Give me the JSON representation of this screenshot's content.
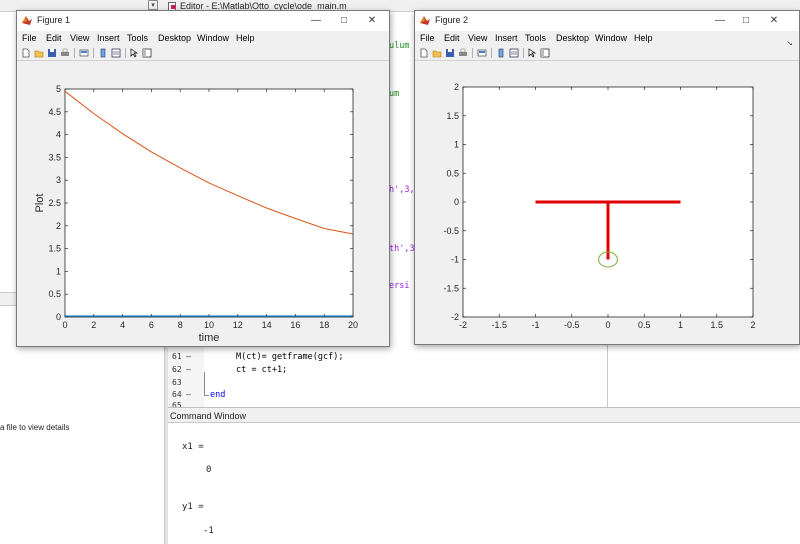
{
  "editor": {
    "title": "Editor - E:\\Matlab\\Otto_cycle\\ode_main.m",
    "code_fragments": [
      {
        "text": "ulum",
        "class": "cmt"
      },
      {
        "text": "um",
        "class": "cmt"
      },
      {
        "text": "h',3,",
        "class": "str"
      },
      {
        "text": "th',3",
        "class": "str"
      },
      {
        "text": "ersi",
        "class": "str"
      }
    ],
    "lines": [
      {
        "num": "61",
        "marker": "—",
        "code": "M(ct)= getframe(gcf);"
      },
      {
        "num": "62",
        "marker": "—",
        "code": "ct = ct+1;"
      },
      {
        "num": "63",
        "marker": "",
        "code": ""
      },
      {
        "num": "64",
        "marker": "—",
        "code": "end"
      },
      {
        "num": "65",
        "marker": "",
        "code": ""
      }
    ]
  },
  "left_panel": {
    "detail_text": "a file to view details"
  },
  "command_window": {
    "header": "Command Window",
    "lines": [
      "x1 =",
      "0",
      "y1 =",
      "-1"
    ]
  },
  "figure1": {
    "title": "Figure 1",
    "menus": [
      "File",
      "Edit",
      "View",
      "Insert",
      "Tools",
      "Desktop",
      "Window",
      "Help"
    ],
    "win_buttons": {
      "minimize": "—",
      "maximize": "□",
      "close": "✕"
    }
  },
  "figure2": {
    "title": "Figure 2",
    "menus": [
      "File",
      "Edit",
      "View",
      "Insert",
      "Tools",
      "Desktop",
      "Window",
      "Help"
    ],
    "win_buttons": {
      "minimize": "—",
      "maximize": "□",
      "close": "✕"
    },
    "dock_arrow": "↘"
  },
  "colors": {
    "curve1": "#d95319",
    "curve2": "#0072bd",
    "pendulum": "#e00000",
    "bob": "#77ac30"
  },
  "chart_data": [
    {
      "type": "line",
      "xlabel": "time",
      "ylabel": "Plot",
      "xlim": [
        0,
        20
      ],
      "ylim": [
        0,
        5
      ],
      "xticks": [
        0,
        2,
        4,
        6,
        8,
        10,
        12,
        14,
        16,
        18,
        20
      ],
      "yticks": [
        0,
        0.5,
        1,
        1.5,
        2,
        2.5,
        3,
        3.5,
        4,
        4.5,
        5
      ],
      "ytick_labels": [
        "0",
        "0.5",
        "1",
        "1.5",
        "2",
        "2.5",
        "3",
        "3.5",
        "4",
        "4.5",
        "5"
      ],
      "grid": false,
      "series": [
        {
          "color": "#d95319",
          "x": [
            0,
            2,
            4,
            6,
            8,
            10,
            12,
            14,
            16,
            18,
            20
          ],
          "y": [
            4.95,
            4.46,
            4.02,
            3.62,
            3.27,
            2.94,
            2.66,
            2.39,
            2.16,
            1.94,
            1.82
          ]
        },
        {
          "color": "#0072bd",
          "x": [
            0,
            20
          ],
          "y": [
            0.02,
            0.02
          ]
        }
      ]
    },
    {
      "type": "line",
      "xlabel": "",
      "ylabel": "",
      "xlim": [
        -2,
        2
      ],
      "ylim": [
        -2,
        2
      ],
      "xticks": [
        -2,
        -1.5,
        -1,
        -0.5,
        0,
        0.5,
        1,
        1.5,
        2
      ],
      "xtick_labels": [
        "-2",
        "-1.5",
        "-1",
        "-0.5",
        "0",
        "0.5",
        "1",
        "1.5",
        "2"
      ],
      "yticks": [
        -2,
        -1.5,
        -1,
        -0.5,
        0,
        0.5,
        1,
        1.5,
        2
      ],
      "ytick_labels": [
        "-2",
        "-1.5",
        "-1",
        "-0.5",
        "0",
        "0.5",
        "1",
        "1.5",
        "2"
      ],
      "grid": false,
      "series": [
        {
          "color": "#e00000",
          "x": [
            -1,
            1
          ],
          "y": [
            0,
            0
          ]
        },
        {
          "color": "#e00000",
          "x": [
            0,
            0
          ],
          "y": [
            0,
            -1
          ]
        }
      ],
      "circle": {
        "cx": 0,
        "cy": -1,
        "r": 0.13,
        "color": "#77ac30"
      }
    }
  ]
}
